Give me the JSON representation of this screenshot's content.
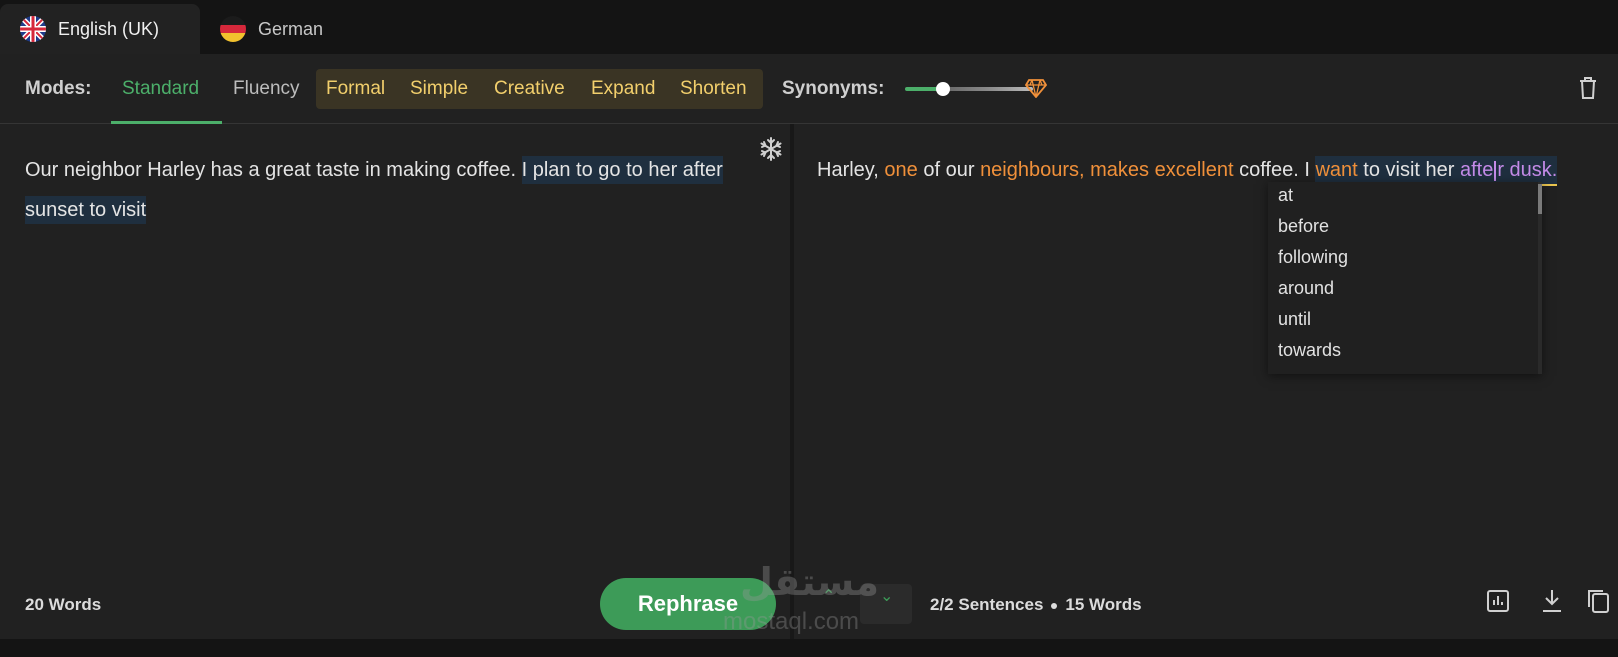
{
  "languages": [
    {
      "label": "English (UK)",
      "icon": "uk-flag-icon",
      "active": true
    },
    {
      "label": "German",
      "icon": "germany-flag-icon",
      "active": false
    }
  ],
  "modes": {
    "label": "Modes:",
    "items": [
      {
        "label": "Standard",
        "active": true
      },
      {
        "label": "Fluency"
      }
    ],
    "premium_items": [
      "Formal",
      "Simple",
      "Creative",
      "Expand",
      "Shorten"
    ]
  },
  "synonyms": {
    "label": "Synonyms:",
    "level": 0.3
  },
  "input": {
    "plain": "Our neighbor Harley has a great taste in making coffee. ",
    "highlighted": "I plan to go to her after sunset to visit"
  },
  "output": {
    "s1": "Harley, ",
    "s2": "one",
    "s3": " of our ",
    "s4": "neighbours, makes excellent",
    "s5": " coffee. I ",
    "s6": "want",
    "s7": " to visit her ",
    "s8a": "afte",
    "s8b": "r dusk."
  },
  "dropdown": [
    "at",
    "before",
    "following",
    "around",
    "until",
    "towards"
  ],
  "footer": {
    "input_words": "20 Words",
    "rephrase": "Rephrase",
    "sentences": "2/2 Sentences",
    "output_words": "15 Words"
  },
  "watermark": {
    "arabic": "مستقل",
    "latin": "mostaql.com"
  },
  "colors": {
    "accent": "#4caf6a",
    "premium": "#f2cf6c",
    "changed": "#f0903a",
    "selected_word": "#c48be8"
  }
}
